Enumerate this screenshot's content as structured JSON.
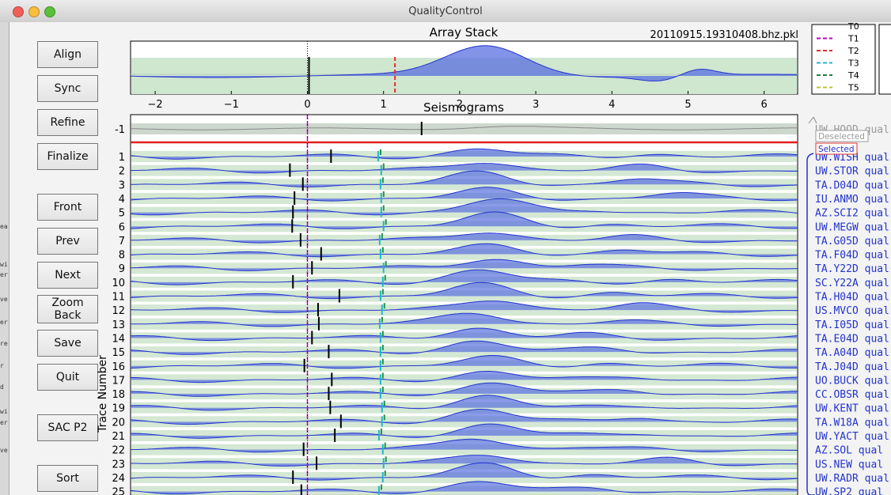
{
  "window": {
    "title": "QualityControl"
  },
  "side_fragments": [
    "ea",
    "wi",
    "er",
    "ve",
    "er",
    "re",
    "r",
    "d",
    "wi",
    "er",
    "ve"
  ],
  "buttons": [
    {
      "id": "align",
      "label": "Align"
    },
    {
      "id": "sync",
      "label": "Sync"
    },
    {
      "id": "refine",
      "label": "Refine"
    },
    {
      "id": "finalize",
      "label": "Finalize"
    },
    {
      "id": "front",
      "label": "Front"
    },
    {
      "id": "prev",
      "label": "Prev"
    },
    {
      "id": "next",
      "label": "Next"
    },
    {
      "id": "zoom-back",
      "label": "Zoom\nBack"
    },
    {
      "id": "save",
      "label": "Save"
    },
    {
      "id": "quit",
      "label": "Quit"
    },
    {
      "id": "sac-p2",
      "label": "SAC P2"
    },
    {
      "id": "sort",
      "label": "Sort"
    }
  ],
  "stack": {
    "title": "Array Stack",
    "filename": "20110915.19310408.bhz.pkl",
    "x_ticks": [
      "−2",
      "−1",
      "0",
      "1",
      "2",
      "3",
      "4",
      "5",
      "6"
    ]
  },
  "legend": {
    "items": [
      {
        "label": "T0",
        "color": "#666666"
      },
      {
        "label": "T1",
        "color": "#c000c0"
      },
      {
        "label": "T2",
        "color": "#e03030"
      },
      {
        "label": "T3",
        "color": "#20b8c8"
      },
      {
        "label": "T4",
        "color": "#208040"
      },
      {
        "label": "T5",
        "color": "#c8c030"
      }
    ]
  },
  "seismograms": {
    "title": "Seismograms",
    "ylabel": "Trace Number",
    "traces": [
      {
        "num": "-1",
        "station": "UW.HOOD",
        "suffix": "qual",
        "deselected": true
      },
      {
        "num": "1",
        "station": "UW.WISH",
        "suffix": "qual"
      },
      {
        "num": "2",
        "station": "UW.STOR",
        "suffix": "qual"
      },
      {
        "num": "3",
        "station": "TA.D04D",
        "suffix": "qual"
      },
      {
        "num": "4",
        "station": "IU.ANMO",
        "suffix": "qual"
      },
      {
        "num": "5",
        "station": "AZ.SCI2",
        "suffix": "qual"
      },
      {
        "num": "6",
        "station": "UW.MEGW",
        "suffix": "qual"
      },
      {
        "num": "7",
        "station": "TA.G05D",
        "suffix": "qual"
      },
      {
        "num": "8",
        "station": "TA.F04D",
        "suffix": "qual"
      },
      {
        "num": "9",
        "station": "TA.Y22D",
        "suffix": "qual"
      },
      {
        "num": "10",
        "station": "SC.Y22A",
        "suffix": "qual"
      },
      {
        "num": "11",
        "station": "TA.H04D",
        "suffix": "qual"
      },
      {
        "num": "12",
        "station": "US.MVCO",
        "suffix": "qual"
      },
      {
        "num": "13",
        "station": "TA.I05D",
        "suffix": "qual"
      },
      {
        "num": "14",
        "station": "TA.E04D",
        "suffix": "qual"
      },
      {
        "num": "15",
        "station": "TA.A04D",
        "suffix": "qual"
      },
      {
        "num": "16",
        "station": "TA.J04D",
        "suffix": "qual"
      },
      {
        "num": "17",
        "station": "UO.BUCK",
        "suffix": "qual"
      },
      {
        "num": "18",
        "station": "CC.OBSR",
        "suffix": "qual"
      },
      {
        "num": "19",
        "station": "UW.KENT",
        "suffix": "qual"
      },
      {
        "num": "20",
        "station": "TA.W18A",
        "suffix": "qual"
      },
      {
        "num": "21",
        "station": "UW.YACT",
        "suffix": "qual"
      },
      {
        "num": "22",
        "station": "AZ.SOL",
        "suffix": "qual"
      },
      {
        "num": "23",
        "station": "US.NEW",
        "suffix": "qual"
      },
      {
        "num": "24",
        "station": "UW.RADR",
        "suffix": "qual"
      },
      {
        "num": "25",
        "station": "UW.SP2",
        "suffix": "qual"
      }
    ]
  },
  "selection_legend": {
    "deselected": "Deselected",
    "selected": "Selected"
  }
}
